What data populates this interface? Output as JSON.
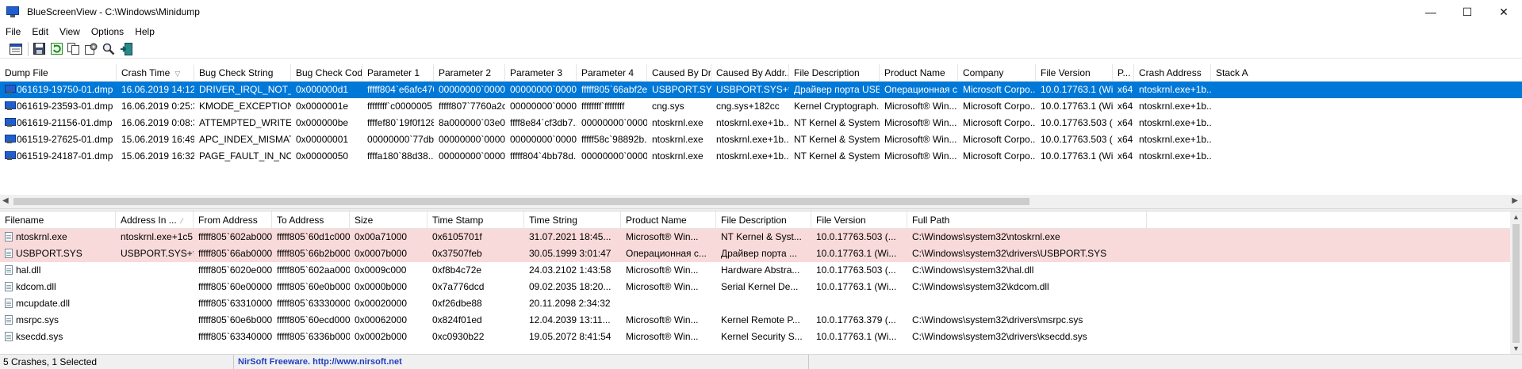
{
  "window": {
    "title": "BlueScreenView  -  C:\\Windows\\Minidump",
    "controls": [
      "—",
      "☐",
      "✕"
    ]
  },
  "menu": [
    "File",
    "Edit",
    "View",
    "Options",
    "Help"
  ],
  "toolbar": [
    "properties-icon",
    "save-icon",
    "refresh-icon",
    "copy-icon",
    "advanced-options-icon",
    "find-icon",
    "exit-icon"
  ],
  "crash_list": {
    "columns": [
      "Dump File",
      "Crash Time",
      "Bug Check String",
      "Bug Check Code",
      "Parameter 1",
      "Parameter 2",
      "Parameter 3",
      "Parameter 4",
      "Caused By Dr...",
      "Caused By Addr...",
      "File Description",
      "Product Name",
      "Company",
      "File Version",
      "P...",
      "Crash Address",
      "Stack A"
    ],
    "sort_column": "Crash Time",
    "rows": [
      {
        "selected": true,
        "cells": [
          "061619-19750-01.dmp",
          "16.06.2019 14:12...",
          "DRIVER_IRQL_NOT_LE...",
          "0x000000d1",
          "fffff804`e6afc470",
          "00000000`0000...",
          "00000000`0000...",
          "fffff805`66abf2ec",
          "USBPORT.SYS",
          "USBPORT.SYS+f2...",
          "Драйвер порта USB...",
          "Операционная с...",
          "Microsoft Corpo...",
          "10.0.17763.1 (Wi...",
          "x64",
          "ntoskrnl.exe+1b...",
          ""
        ]
      },
      {
        "selected": false,
        "cells": [
          "061619-23593-01.dmp",
          "16.06.2019 0:25:31",
          "KMODE_EXCEPTION_...",
          "0x0000001e",
          "ffffffff`c0000005",
          "fffff807`7760a2cc",
          "00000000`0000...",
          "ffffffff`ffffffff",
          "cng.sys",
          "cng.sys+182cc",
          "Kernel Cryptograph...",
          "Microsoft® Win...",
          "Microsoft Corpo...",
          "10.0.17763.1 (Wi...",
          "x64",
          "ntoskrnl.exe+1b...",
          ""
        ]
      },
      {
        "selected": false,
        "cells": [
          "061619-21156-01.dmp",
          "16.06.2019 0:08:34",
          "ATTEMPTED_WRITE_T...",
          "0x000000be",
          "ffffef80`19f0f128",
          "8a000000`03e0...",
          "ffff8e84`cf3db7...",
          "00000000`0000...",
          "ntoskrnl.exe",
          "ntoskrnl.exe+1b...",
          "NT Kernel & System",
          "Microsoft® Win...",
          "Microsoft Corpo...",
          "10.0.17763.503 (...",
          "x64",
          "ntoskrnl.exe+1b...",
          ""
        ]
      },
      {
        "selected": false,
        "cells": [
          "061519-27625-01.dmp",
          "15.06.2019 16:49...",
          "APC_INDEX_MISMATCH",
          "0x00000001",
          "00000000`77db...",
          "00000000`0000...",
          "00000000`0000...",
          "fffff58c`98892b...",
          "ntoskrnl.exe",
          "ntoskrnl.exe+1b...",
          "NT Kernel & System",
          "Microsoft® Win...",
          "Microsoft Corpo...",
          "10.0.17763.503 (...",
          "x64",
          "ntoskrnl.exe+1b...",
          ""
        ]
      },
      {
        "selected": false,
        "cells": [
          "061519-24187-01.dmp",
          "15.06.2019 16:32...",
          "PAGE_FAULT_IN_NONP...",
          "0x00000050",
          "ffffa180`88d38...",
          "00000000`0000...",
          "fffff804`4bb78d...",
          "00000000`0000...",
          "ntoskrnl.exe",
          "ntoskrnl.exe+1b...",
          "NT Kernel & System",
          "Microsoft® Win...",
          "Microsoft Corpo...",
          "10.0.17763.1 (Wi...",
          "x64",
          "ntoskrnl.exe+1b...",
          ""
        ]
      }
    ]
  },
  "driver_list": {
    "columns": [
      "Filename",
      "Address In ...",
      "From Address",
      "To Address",
      "Size",
      "Time Stamp",
      "Time String",
      "Product Name",
      "File Description",
      "File Version",
      "Full Path"
    ],
    "sort_column": "Address In ...",
    "rows": [
      {
        "highlight": true,
        "cells": [
          "ntoskrnl.exe",
          "ntoskrnl.exe+1c5...",
          "fffff805`602ab000",
          "fffff805`60d1c000",
          "0x00a71000",
          "0x6105701f",
          "31.07.2021 18:45...",
          "Microsoft® Win...",
          "NT Kernel & Syst...",
          "10.0.17763.503 (...",
          "C:\\Windows\\system32\\ntoskrnl.exe"
        ]
      },
      {
        "highlight": true,
        "cells": [
          "USBPORT.SYS",
          "USBPORT.SYS+f2...",
          "fffff805`66ab0000",
          "fffff805`66b2b000",
          "0x0007b000",
          "0x37507feb",
          "30.05.1999 3:01:47",
          "Операционная с...",
          "Драйвер порта ...",
          "10.0.17763.1 (Wi...",
          "C:\\Windows\\system32\\drivers\\USBPORT.SYS"
        ]
      },
      {
        "highlight": false,
        "cells": [
          "hal.dll",
          "",
          "fffff805`6020e000",
          "fffff805`602aa000",
          "0x0009c000",
          "0xf8b4c72e",
          "24.03.2102 1:43:58",
          "Microsoft® Win...",
          "Hardware Abstra...",
          "10.0.17763.503 (...",
          "C:\\Windows\\system32\\hal.dll"
        ]
      },
      {
        "highlight": false,
        "cells": [
          "kdcom.dll",
          "",
          "fffff805`60e00000",
          "fffff805`60e0b000",
          "0x0000b000",
          "0x7a776dcd",
          "09.02.2035 18:20...",
          "Microsoft® Win...",
          "Serial Kernel De...",
          "10.0.17763.1 (Wi...",
          "C:\\Windows\\system32\\kdcom.dll"
        ]
      },
      {
        "highlight": false,
        "cells": [
          "mcupdate.dll",
          "",
          "fffff805`63310000",
          "fffff805`63330000",
          "0x00020000",
          "0xf26dbe88",
          "20.11.2098 2:34:32",
          "",
          "",
          "",
          ""
        ]
      },
      {
        "highlight": false,
        "cells": [
          "msrpc.sys",
          "",
          "fffff805`60e6b000",
          "fffff805`60ecd000",
          "0x00062000",
          "0x824f01ed",
          "12.04.2039 13:11...",
          "Microsoft® Win...",
          "Kernel Remote P...",
          "10.0.17763.379 (...",
          "C:\\Windows\\system32\\drivers\\msrpc.sys"
        ]
      },
      {
        "highlight": false,
        "cells": [
          "ksecdd.sys",
          "",
          "fffff805`63340000",
          "fffff805`6336b000",
          "0x0002b000",
          "0xc0930b22",
          "19.05.2072 8:41:54",
          "Microsoft® Win...",
          "Kernel Security S...",
          "10.0.17763.1 (Wi...",
          "C:\\Windows\\system32\\drivers\\ksecdd.sys"
        ]
      }
    ]
  },
  "status": {
    "summary": "5 Crashes, 1 Selected",
    "credit": "NirSoft Freeware.  http://www.nirsoft.net"
  }
}
